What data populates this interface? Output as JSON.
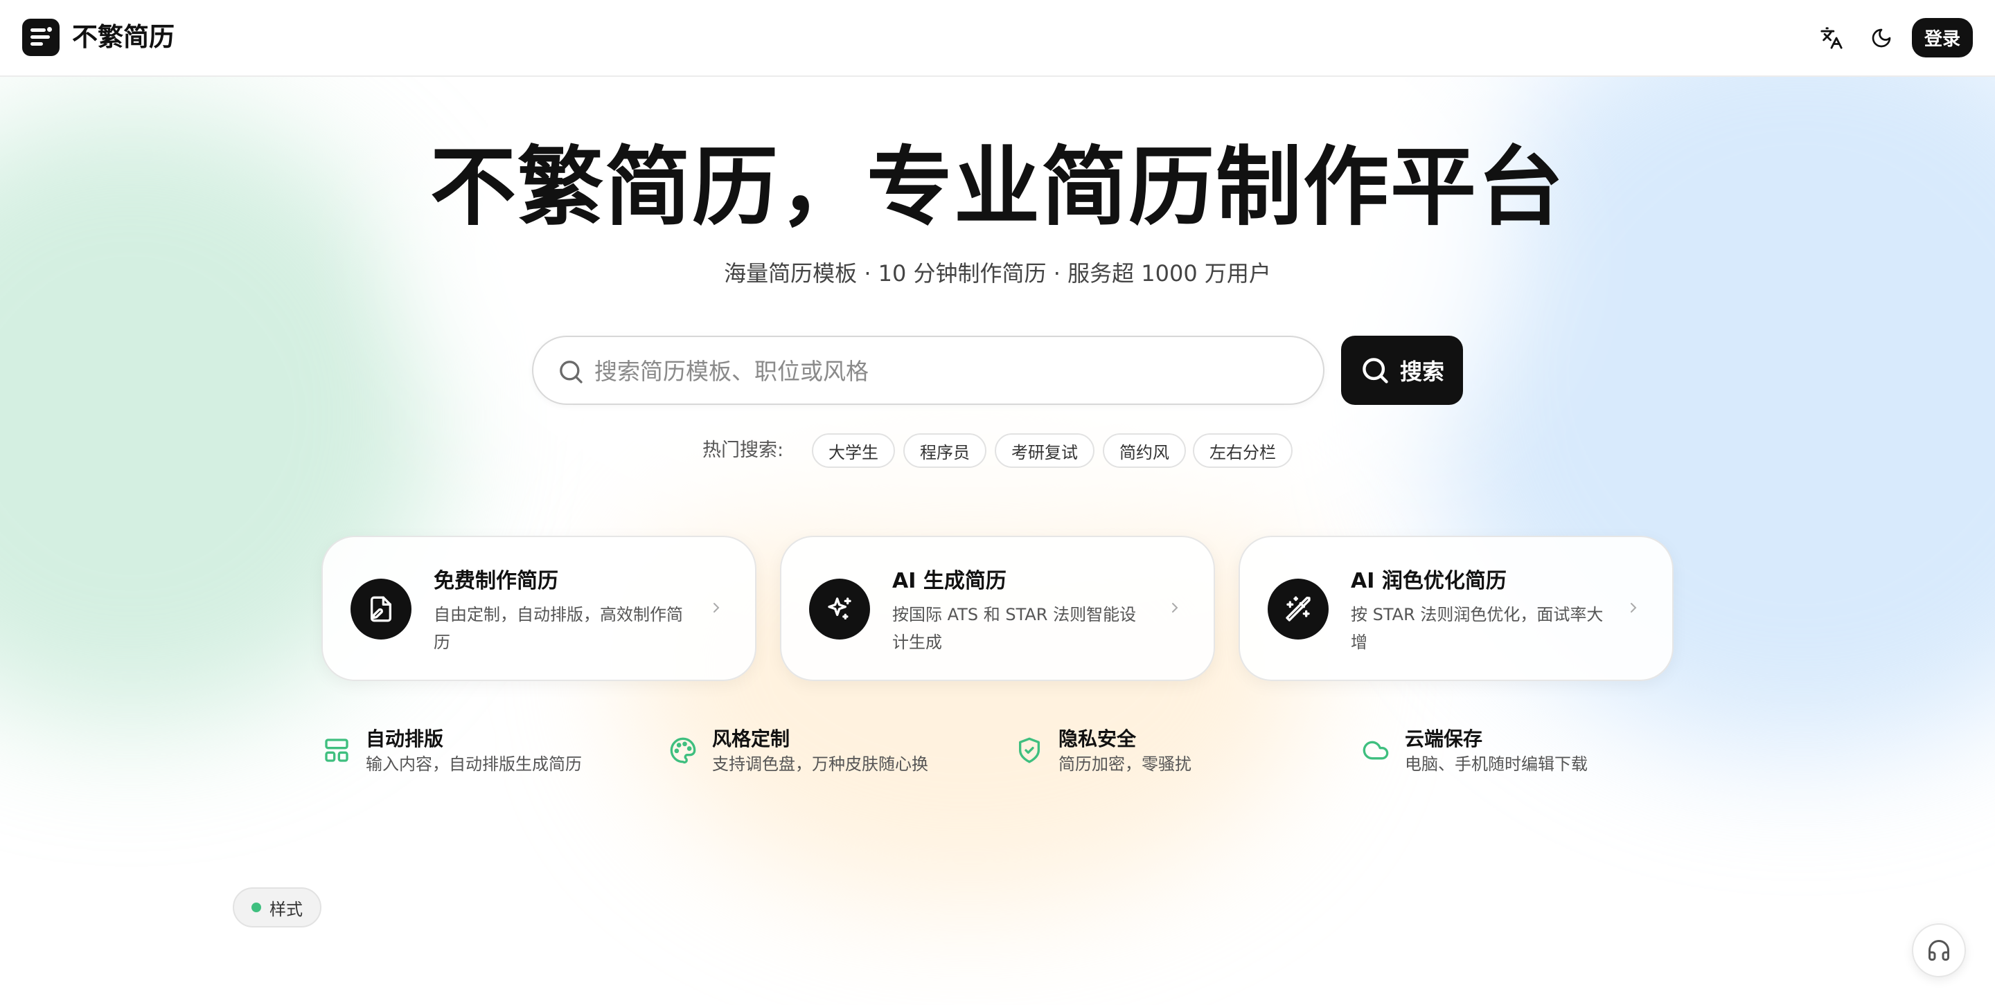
{
  "header": {
    "brand": "不繁简历",
    "login_label": "登录"
  },
  "hero": {
    "title": "不繁简历，专业简历制作平台",
    "subtitle": "海量简历模板 · 10 分钟制作简历 · 服务超 1000 万用户",
    "search_placeholder": "搜索简历模板、职位或风格",
    "search_value": "",
    "search_button": "搜索",
    "hot_label": "热门搜索:",
    "hot_tags": [
      "大学生",
      "程序员",
      "考研复试",
      "简约风",
      "左右分栏"
    ]
  },
  "cards": [
    {
      "title": "免费制作简历",
      "desc": "自由定制，自动排版，高效制作简历",
      "icon": "file-edit-icon"
    },
    {
      "title": "AI 生成简历",
      "desc": "按国际 ATS 和 STAR 法则智能设计生成",
      "icon": "sparkles-icon"
    },
    {
      "title": "AI 润色优化简历",
      "desc": "按 STAR 法则润色优化，面试率大增",
      "icon": "magic-wand-icon"
    }
  ],
  "features": [
    {
      "title": "自动排版",
      "desc": "输入内容，自动排版生成简历",
      "icon": "layout-icon"
    },
    {
      "title": "风格定制",
      "desc": "支持调色盘，万种皮肤随心换",
      "icon": "palette-icon"
    },
    {
      "title": "隐私安全",
      "desc": "简历加密，零骚扰",
      "icon": "shield-check-icon"
    },
    {
      "title": "云端保存",
      "desc": "电脑、手机随时编辑下载",
      "icon": "cloud-icon"
    }
  ],
  "style_badge": "样式",
  "colors": {
    "primary": "#111111",
    "accent_green": "#3fbf7f"
  }
}
